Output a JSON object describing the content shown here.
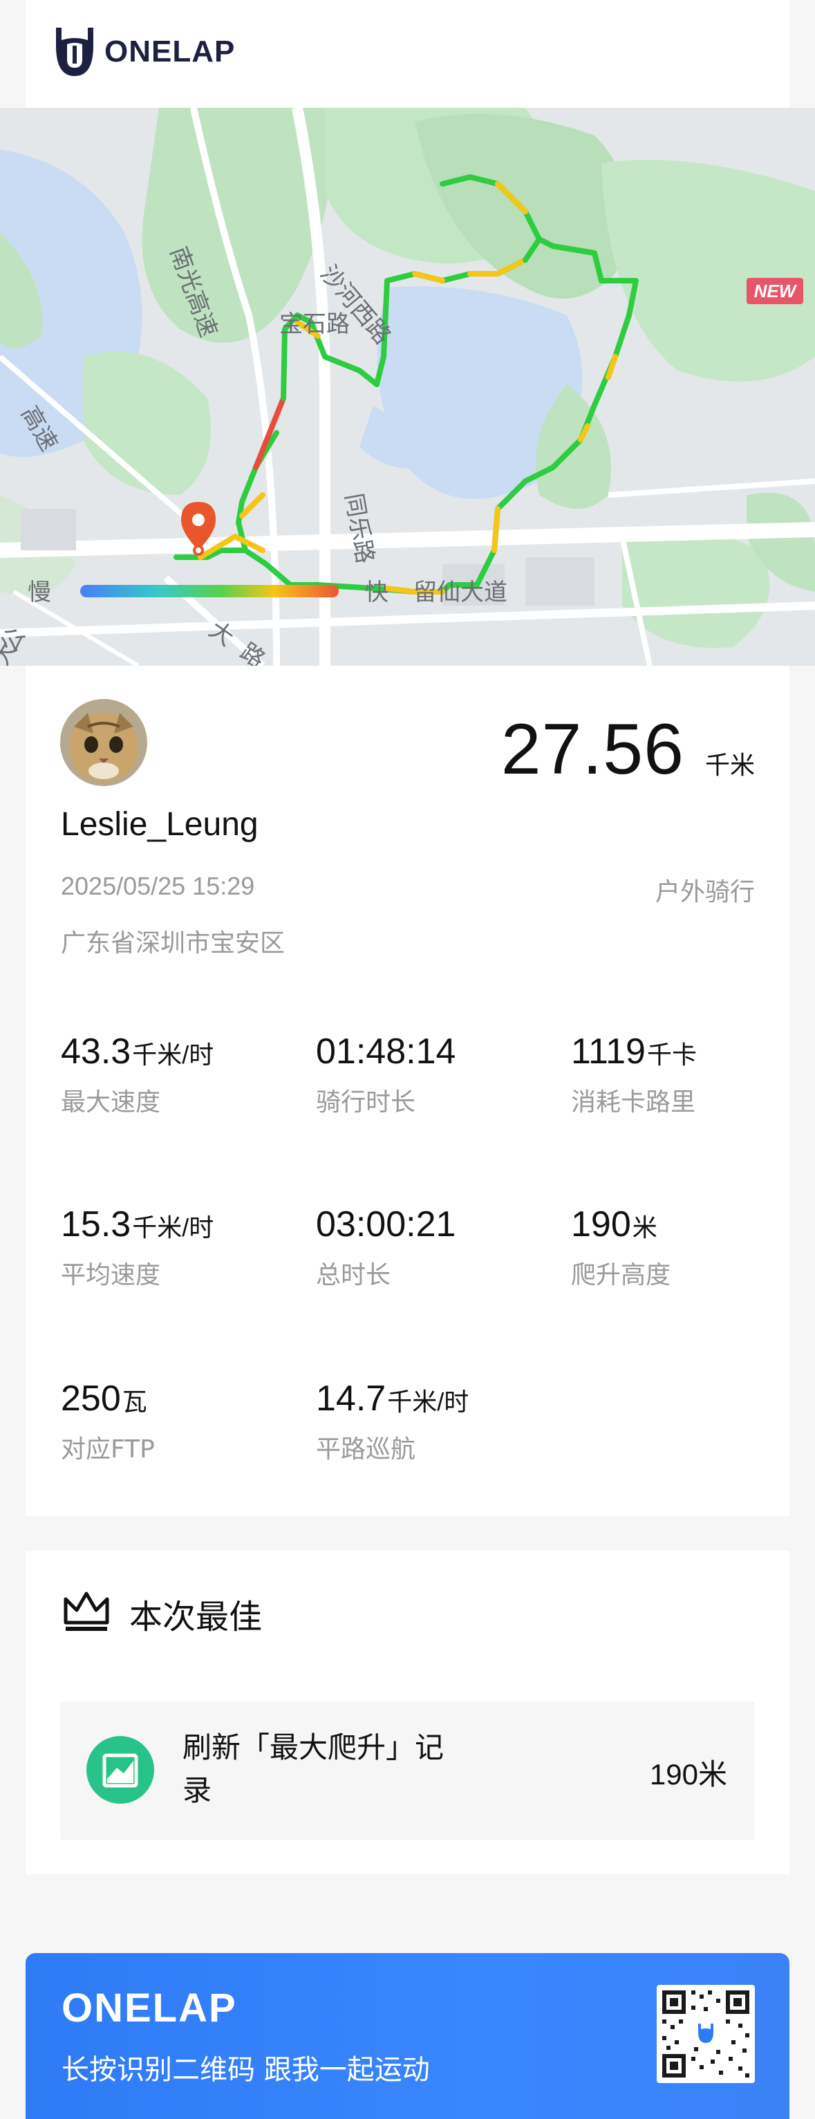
{
  "brand": {
    "name": "ONELAP"
  },
  "map": {
    "badge": "NEW",
    "road_labels": [
      "南光高速",
      "宝石路",
      "沙河西路",
      "同乐路",
      "留仙大道",
      "慢",
      "快",
      "大",
      "路",
      "大",
      "公",
      "高速"
    ]
  },
  "ride": {
    "distance": "27.56",
    "distance_unit": "千米",
    "username": "Leslie_Leung",
    "datetime": "2025/05/25 15:29",
    "type": "户外骑行",
    "location": "广东省深圳市宝安区"
  },
  "stats": [
    {
      "value": "43.3",
      "unit": "千米/时",
      "label": "最大速度"
    },
    {
      "value": "01:48:14",
      "unit": "",
      "label": "骑行时长"
    },
    {
      "value": "1119",
      "unit": "千卡",
      "label": "消耗卡路里"
    },
    {
      "value": "15.3",
      "unit": "千米/时",
      "label": "平均速度"
    },
    {
      "value": "03:00:21",
      "unit": "",
      "label": "总时长"
    },
    {
      "value": "190",
      "unit": "米",
      "label": "爬升高度"
    },
    {
      "value": "250",
      "unit": "瓦",
      "label": "对应FTP"
    },
    {
      "value": "14.7",
      "unit": "千米/时",
      "label": "平路巡航"
    }
  ],
  "best": {
    "title": "本次最佳",
    "record_title": "刷新「最大爬升」记录",
    "record_value": "190米"
  },
  "footer": {
    "logo": "ONELAP",
    "slogan": "长按识别二维码 跟我一起运动"
  },
  "colors": {
    "accent": "#2f7bf5",
    "record_green": "#27c38a",
    "route_green": "#2ecc40",
    "route_yellow": "#f5c518",
    "route_red": "#e74c3c"
  }
}
